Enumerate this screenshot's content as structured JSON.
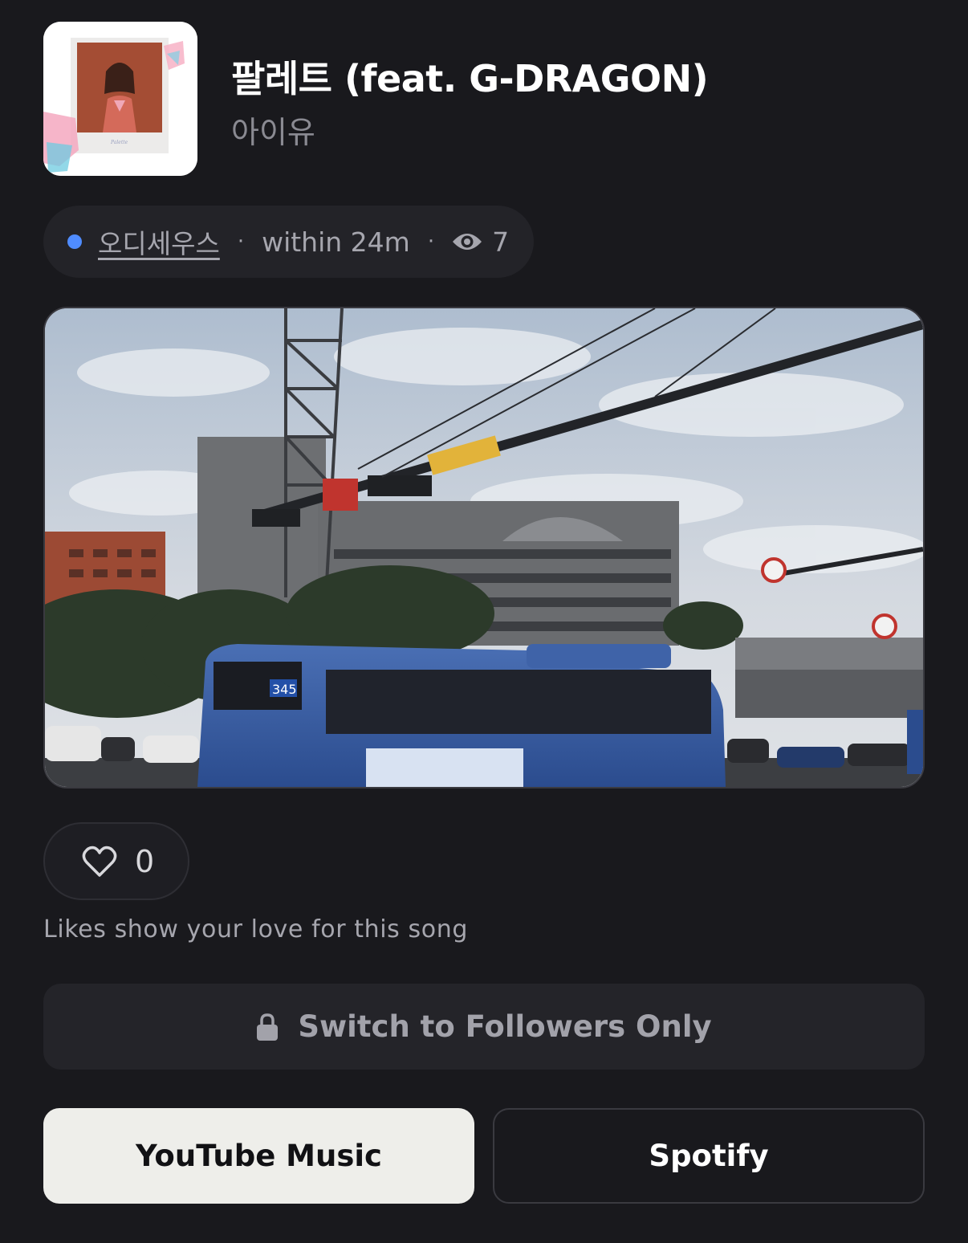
{
  "song": {
    "title": "팔레트 (feat. G-DRAGON)",
    "artist": "아이유"
  },
  "post_meta": {
    "author": "오디세우스",
    "separator": "·",
    "time": "within 24m",
    "views": "7",
    "status_color": "#4f8cff"
  },
  "likes": {
    "count": "0",
    "hint": "Likes show your love for this song"
  },
  "visibility": {
    "button_label": "Switch to Followers Only"
  },
  "streaming": {
    "youtube_label": "YouTube Music",
    "spotify_label": "Spotify"
  },
  "icons": {
    "status": "status-dot",
    "views": "eye-icon",
    "like": "heart-outline-icon",
    "visibility": "lock-icon"
  }
}
